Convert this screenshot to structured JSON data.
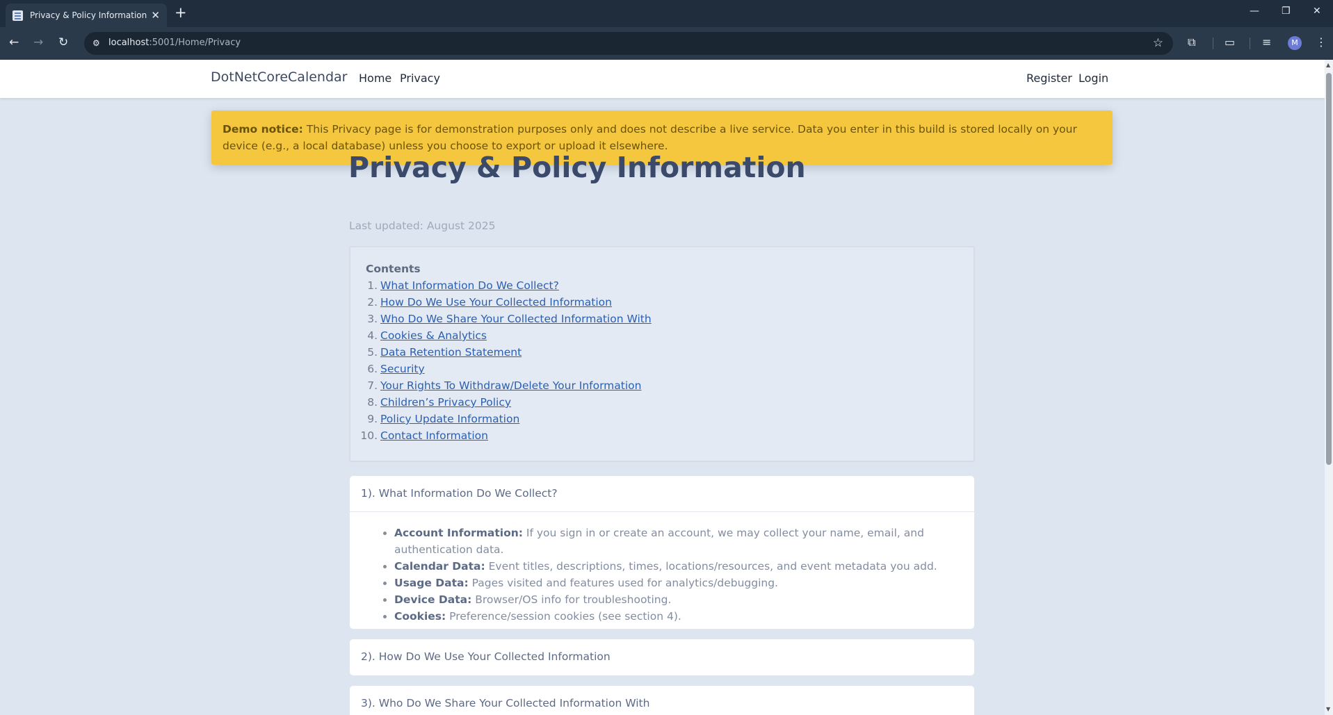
{
  "browser": {
    "tab_title": "Privacy & Policy Information - D",
    "tab_close": "✕",
    "new_tab": "+",
    "url_host": "localhost",
    "url_path": ":5001/Home/Privacy",
    "avatar_letter": "M",
    "window": {
      "minimize": "—",
      "restore": "❐",
      "close": "✕"
    }
  },
  "navbar": {
    "brand": "DotNetCoreCalendar",
    "links": [
      "Home",
      "Privacy"
    ],
    "right_links": [
      "Register",
      "Login"
    ]
  },
  "notice": {
    "label": "Demo notice:",
    "text": " This Privacy page is for demonstration purposes only and does not describe a live service. Data you enter in this build is stored locally on your device (e.g., a local database) unless you choose to export or upload it elsewhere."
  },
  "page": {
    "title": "Privacy & Policy Information",
    "updated": "Last updated: August 2025"
  },
  "toc": {
    "heading": "Contents",
    "items": [
      {
        "num": "1.",
        "label": "What Information Do We Collect?"
      },
      {
        "num": "2.",
        "label": "How Do We Use Your Collected Information"
      },
      {
        "num": "3.",
        "label": "Who Do We Share Your Collected Information With"
      },
      {
        "num": "4.",
        "label": "Cookies & Analytics"
      },
      {
        "num": "5.",
        "label": "Data Retention Statement"
      },
      {
        "num": "6.",
        "label": "Security"
      },
      {
        "num": "7.",
        "label": "Your Rights To Withdraw/Delete Your Information"
      },
      {
        "num": "8.",
        "label": "Children’s Privacy Policy"
      },
      {
        "num": "9.",
        "label": "Policy Update Information"
      },
      {
        "num": "10.",
        "label": "Contact Information"
      }
    ]
  },
  "sections": [
    {
      "title": "1). What Information Do We Collect?",
      "items": [
        {
          "label": "Account Information:",
          "text": " If you sign in or create an account, we may collect your name, email, and authentication data."
        },
        {
          "label": "Calendar Data:",
          "text": " Event titles, descriptions, times, locations/resources, and event metadata you add."
        },
        {
          "label": "Usage Data:",
          "text": " Pages visited and features used for analytics/debugging."
        },
        {
          "label": "Device Data:",
          "text": " Browser/OS info for troubleshooting."
        },
        {
          "label": "Cookies:",
          "text": " Preference/session cookies (see section 4)."
        }
      ]
    },
    {
      "title": "2). How Do We Use Your Collected Information"
    },
    {
      "title": "3). Who Do We Share Your Collected Information With"
    }
  ],
  "colors": {
    "page_bg": "#dde5f1",
    "notice_bg": "#f4c73f",
    "link": "#2b5fb0",
    "title": "#3b4a6a"
  }
}
